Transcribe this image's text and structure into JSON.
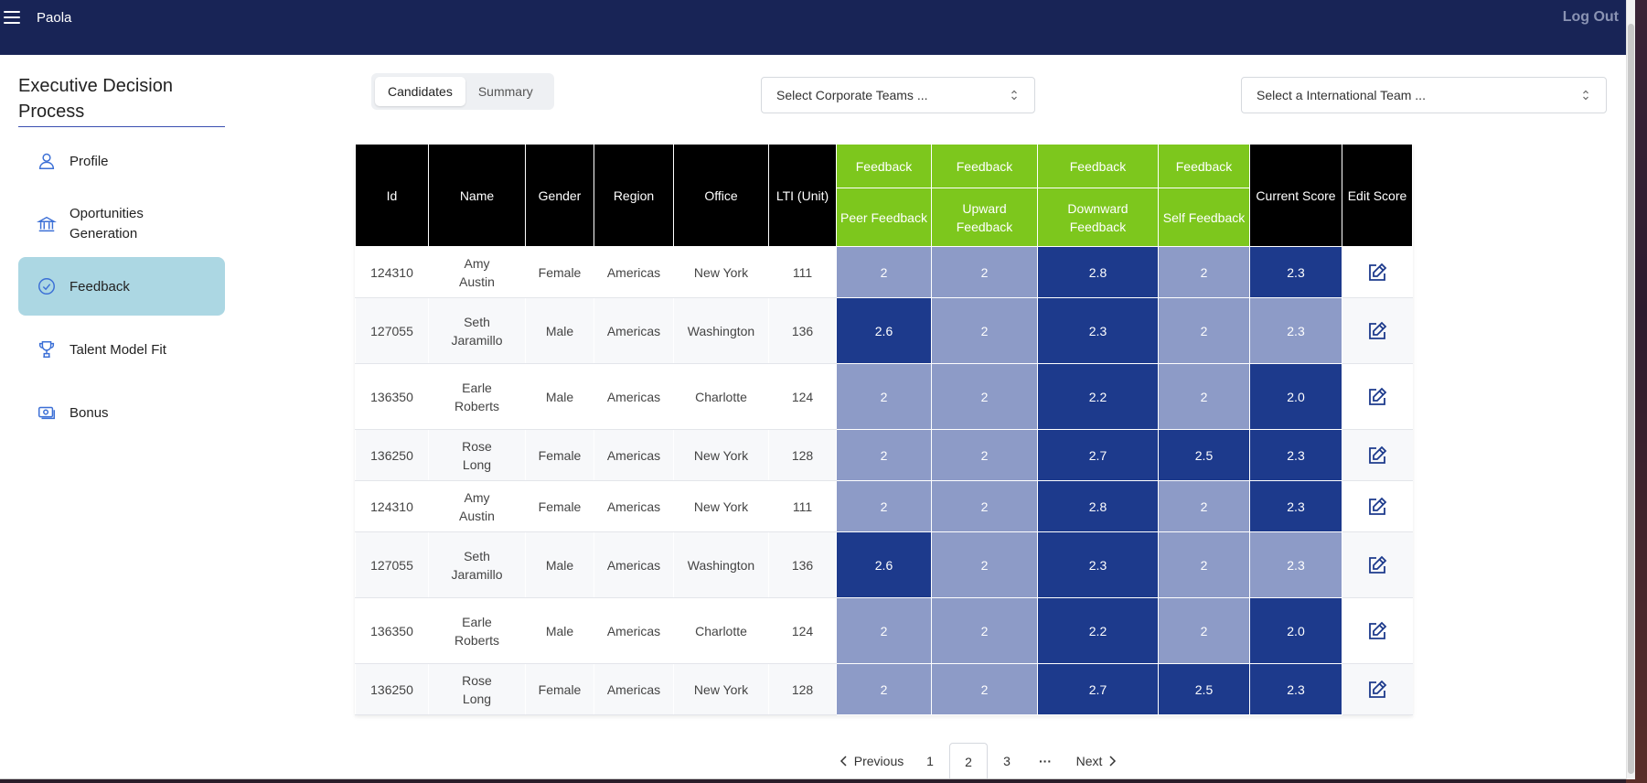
{
  "header": {
    "user_name": "Paola",
    "logout_label": "Log Out"
  },
  "sidebar": {
    "title": "Executive Decision Process",
    "items": [
      {
        "label": "Profile",
        "icon": "person-icon"
      },
      {
        "label": "Oportunities Generation",
        "icon": "bank-icon"
      },
      {
        "label": "Feedback",
        "icon": "check-circle-icon",
        "active": true
      },
      {
        "label": "Talent Model Fit",
        "icon": "trophy-icon"
      },
      {
        "label": "Bonus",
        "icon": "cash-icon"
      }
    ]
  },
  "tabs": {
    "candidates": "Candidates",
    "summary": "Summary",
    "active": "Candidates"
  },
  "filters": {
    "corporate_placeholder": "Select Corporate Teams ...",
    "international_placeholder": "Select a International Team ..."
  },
  "table": {
    "headers": {
      "id": "Id",
      "name": "Name",
      "gender": "Gender",
      "region": "Region",
      "office": "Office",
      "lti": "LTI (Unit)",
      "feedback_group": "Feedback",
      "peer": "Peer Feedback",
      "upward": "Upward Feedback",
      "downward": "Downward Feedback",
      "self": "Self Feedback",
      "current": "Current Score",
      "edit": "Edit Score"
    },
    "rows": [
      {
        "id": "124310",
        "name": "Amy Austin",
        "gender": "Female",
        "region": "Americas",
        "office": "New York",
        "lti": "111",
        "peer": "2",
        "upward": "2",
        "downward": "2.8",
        "self": "2",
        "current": "2.3"
      },
      {
        "id": "127055",
        "name": "Seth Jaramillo",
        "gender": "Male",
        "region": "Americas",
        "office": "Washington",
        "lti": "136",
        "peer": "2.6",
        "upward": "2",
        "downward": "2.3",
        "self": "2",
        "current": "2.3"
      },
      {
        "id": "136350",
        "name": "Earle Roberts",
        "gender": "Male",
        "region": "Americas",
        "office": "Charlotte",
        "lti": "124",
        "peer": "2",
        "upward": "2",
        "downward": "2.2",
        "self": "2",
        "current": "2.0"
      },
      {
        "id": "136250",
        "name": "Rose Long",
        "gender": "Female",
        "region": "Americas",
        "office": "New York",
        "lti": "128",
        "peer": "2",
        "upward": "2",
        "downward": "2.7",
        "self": "2.5",
        "current": "2.3"
      },
      {
        "id": "124310",
        "name": "Amy Austin",
        "gender": "Female",
        "region": "Americas",
        "office": "New York",
        "lti": "111",
        "peer": "2",
        "upward": "2",
        "downward": "2.8",
        "self": "2",
        "current": "2.3"
      },
      {
        "id": "127055",
        "name": "Seth Jaramillo",
        "gender": "Male",
        "region": "Americas",
        "office": "Washington",
        "lti": "136",
        "peer": "2.6",
        "upward": "2",
        "downward": "2.3",
        "self": "2",
        "current": "2.3"
      },
      {
        "id": "136350",
        "name": "Earle Roberts",
        "gender": "Male",
        "region": "Americas",
        "office": "Charlotte",
        "lti": "124",
        "peer": "2",
        "upward": "2",
        "downward": "2.2",
        "self": "2",
        "current": "2.0"
      },
      {
        "id": "136250",
        "name": "Rose Long",
        "gender": "Female",
        "region": "Americas",
        "office": "New York",
        "lti": "128",
        "peer": "2",
        "upward": "2",
        "downward": "2.7",
        "self": "2.5",
        "current": "2.3"
      }
    ]
  },
  "pagination": {
    "previous": "Previous",
    "pages": [
      "1",
      "2",
      "3"
    ],
    "current": "2",
    "ellipsis": "···",
    "next": "Next"
  },
  "colors": {
    "header_navy": "#182456",
    "feedback_green": "#7dc71d",
    "cell_dark": "#1d3a8c",
    "cell_light": "#8d9bc7",
    "active_nav": "#acd7e3"
  }
}
